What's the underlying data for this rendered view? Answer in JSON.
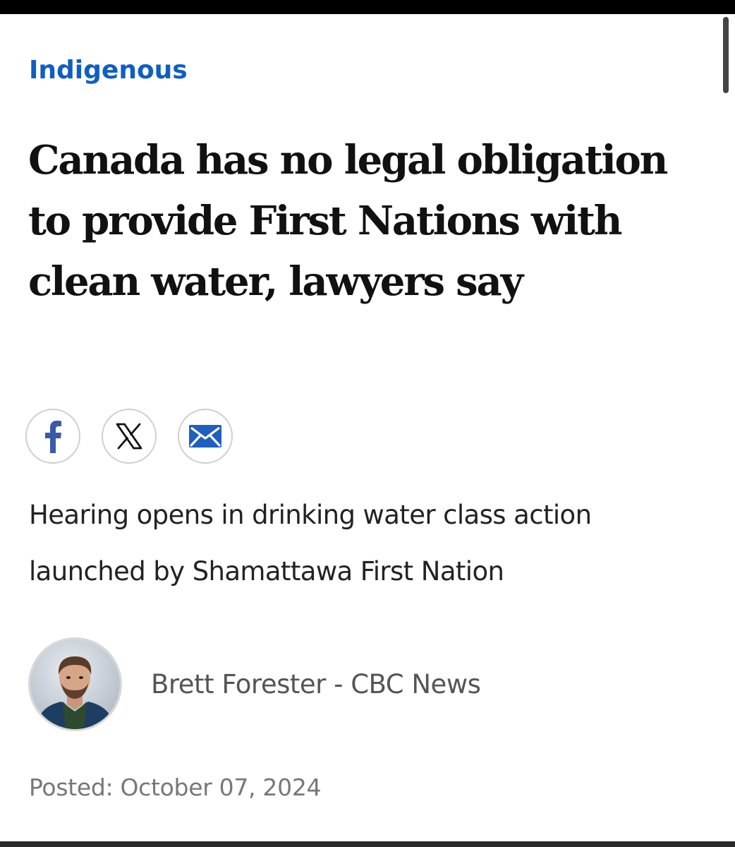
{
  "article": {
    "category": "Indigenous",
    "headline": "Canada has no legal obligation to provide First Nations with clean water, lawyers say",
    "dek": "Hearing opens in drinking water class action launched by Shamattawa First Nation",
    "byline": "Brett Forester - CBC News",
    "posted": "Posted: October 07, 2024"
  },
  "share": {
    "icons": [
      "facebook-icon",
      "x-icon",
      "email-icon"
    ]
  },
  "colors": {
    "accent": "#0f5ec4",
    "headline": "#111111",
    "byline": "#555555",
    "posted": "#777777"
  }
}
